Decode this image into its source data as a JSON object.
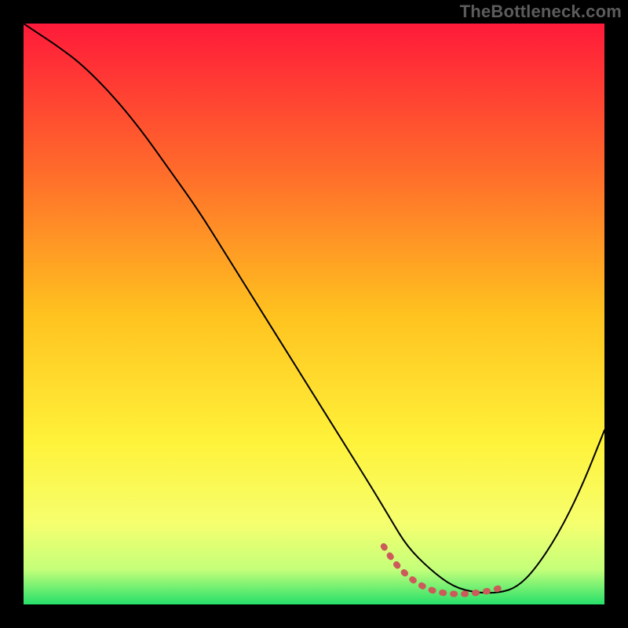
{
  "watermark": "TheBottleneck.com",
  "chart_data": {
    "type": "line",
    "title": "",
    "xlabel": "",
    "ylabel": "",
    "xlim": [
      0,
      100
    ],
    "ylim": [
      0,
      100
    ],
    "grid": false,
    "legend": false,
    "background_gradient": {
      "stops": [
        {
          "offset": 0.0,
          "color": "#ff1a3a"
        },
        {
          "offset": 0.25,
          "color": "#ff6a2b"
        },
        {
          "offset": 0.5,
          "color": "#ffc21f"
        },
        {
          "offset": 0.72,
          "color": "#fff23a"
        },
        {
          "offset": 0.86,
          "color": "#f6ff6e"
        },
        {
          "offset": 0.94,
          "color": "#c4ff7a"
        },
        {
          "offset": 1.0,
          "color": "#26e06a"
        }
      ]
    },
    "series": [
      {
        "name": "bottleneck-curve",
        "stroke": "#000000",
        "stroke_width": 2,
        "x": [
          0,
          3,
          6,
          10,
          15,
          20,
          25,
          30,
          35,
          40,
          45,
          50,
          55,
          60,
          63,
          66,
          70,
          74,
          78,
          82,
          85,
          88,
          92,
          96,
          100
        ],
        "y": [
          100,
          98,
          96,
          93,
          88,
          82,
          75,
          68,
          60,
          52,
          44,
          36,
          28,
          20,
          15,
          10,
          6,
          3,
          2,
          2,
          3,
          6,
          12,
          20,
          30
        ]
      },
      {
        "name": "optimal-band",
        "stroke": "#cc5a5a",
        "stroke_width": 8,
        "x": [
          62,
          64,
          66,
          68,
          70,
          72,
          74,
          76,
          78,
          80,
          82,
          83
        ],
        "y": [
          10,
          7,
          5,
          3.5,
          2.5,
          2,
          1.8,
          1.8,
          2,
          2.3,
          2.8,
          3.2
        ]
      }
    ]
  }
}
